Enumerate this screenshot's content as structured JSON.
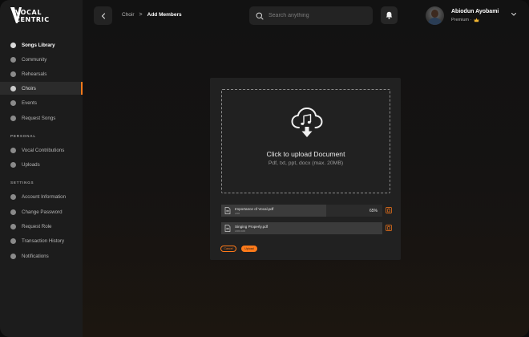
{
  "brand": {
    "line1": "VOCAL",
    "line2": "CENTRIC"
  },
  "sidebar": {
    "items": [
      {
        "label": "Songs Library",
        "icon": "music-note-icon"
      },
      {
        "label": "Community",
        "icon": "people-icon"
      },
      {
        "label": "Rehearsals",
        "icon": "microphone-icon"
      },
      {
        "label": "Choirs",
        "icon": "choir-icon"
      },
      {
        "label": "Events",
        "icon": "calendar-icon"
      },
      {
        "label": "Request Songs",
        "icon": "request-icon"
      }
    ],
    "personal_heading": "PERSONAL",
    "personal": [
      {
        "label": "Vocal Contributions",
        "icon": "vocal-icon"
      },
      {
        "label": "Uploads",
        "icon": "upload-icon"
      }
    ],
    "settings_heading": "SETTINGS",
    "settings": [
      {
        "label": "Account Information",
        "icon": "account-icon"
      },
      {
        "label": "Change Password",
        "icon": "lock-icon"
      },
      {
        "label": "Request Role",
        "icon": "role-icon"
      },
      {
        "label": "Transaction History",
        "icon": "history-icon"
      },
      {
        "label": "Notifications",
        "icon": "bell-icon"
      }
    ]
  },
  "header": {
    "breadcrumb": {
      "parent": "Choir",
      "separator": ">",
      "current": "Add Members"
    },
    "search_placeholder": "Search anything",
    "user": {
      "name": "Abiodun Ayobami",
      "tier": "Premium ·"
    }
  },
  "upload": {
    "title": "Click to upload Document",
    "subtitle": "Pdf, txt, ppt, docx  (max. 20MB)",
    "files": [
      {
        "name": "Importance of Vocal.pdf",
        "size": "2MB",
        "progress_percent": 65,
        "progress_label": "65%"
      },
      {
        "name": "Singing Properly.pdf",
        "size": "2MB/3MB",
        "progress_percent": 100,
        "progress_label": ""
      }
    ],
    "cancel_label": "Cancel",
    "upload_label": "Upload"
  },
  "colors": {
    "accent": "#ff7a1a",
    "sidebar_bg": "#1c1c1c",
    "card_bg": "#212121"
  }
}
